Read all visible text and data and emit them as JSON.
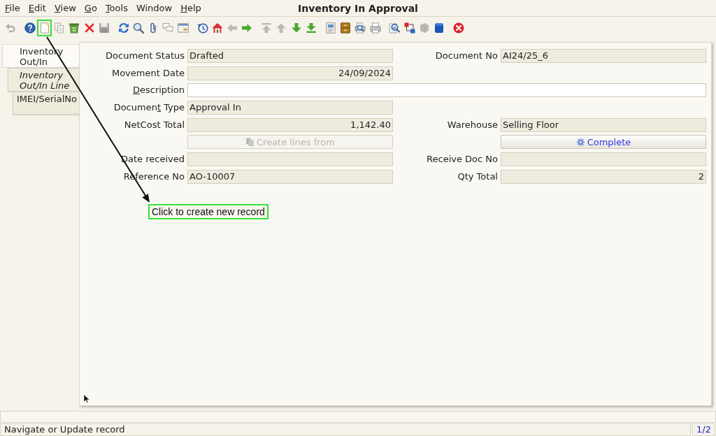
{
  "menu_bar": {
    "items": [
      {
        "label": "File",
        "access_key": true
      },
      {
        "label": "Edit",
        "access_key": true
      },
      {
        "label": "View",
        "access_key": true
      },
      {
        "label": "Go",
        "access_key": true
      },
      {
        "label": "Tools",
        "access_key": true
      },
      {
        "label": "Window",
        "access_key": false
      },
      {
        "label": "Help",
        "access_key": true
      }
    ]
  },
  "window": {
    "title": "Inventory In Approval"
  },
  "toolbar": {
    "groups": [
      {
        "buttons": [
          {
            "kind": "undo",
            "disabled": true,
            "highlighted": false
          }
        ]
      },
      {
        "buttons": [
          {
            "kind": "help",
            "disabled": false,
            "highlighted": false
          },
          {
            "kind": "new",
            "disabled": false,
            "highlighted": true
          },
          {
            "kind": "copy",
            "disabled": false,
            "highlighted": false
          },
          {
            "kind": "bin",
            "disabled": false,
            "highlighted": false
          },
          {
            "kind": "delete",
            "disabled": false,
            "highlighted": false
          },
          {
            "kind": "save",
            "disabled": true,
            "highlighted": false
          }
        ]
      },
      {
        "buttons": [
          {
            "kind": "refresh",
            "disabled": false,
            "highlighted": false
          },
          {
            "kind": "search",
            "disabled": false,
            "highlighted": false
          },
          {
            "kind": "attach",
            "disabled": false,
            "highlighted": false
          },
          {
            "kind": "chat",
            "disabled": false,
            "highlighted": false
          },
          {
            "kind": "table",
            "disabled": false,
            "highlighted": false
          }
        ]
      },
      {
        "buttons": [
          {
            "kind": "history",
            "disabled": false,
            "highlighted": false
          },
          {
            "kind": "home",
            "disabled": false,
            "highlighted": false
          },
          {
            "kind": "prev",
            "disabled": true,
            "highlighted": false
          },
          {
            "kind": "next",
            "disabled": false,
            "highlighted": false
          }
        ]
      },
      {
        "buttons": [
          {
            "kind": "first",
            "disabled": true,
            "highlighted": false
          },
          {
            "kind": "up",
            "disabled": true,
            "highlighted": false
          },
          {
            "kind": "down",
            "disabled": false,
            "highlighted": false
          },
          {
            "kind": "last",
            "disabled": false,
            "highlighted": false
          }
        ]
      },
      {
        "buttons": [
          {
            "kind": "report",
            "disabled": false,
            "highlighted": false
          },
          {
            "kind": "archive",
            "disabled": false,
            "highlighted": false
          },
          {
            "kind": "preview",
            "disabled": false,
            "highlighted": false
          },
          {
            "kind": "print",
            "disabled": false,
            "highlighted": false
          }
        ]
      },
      {
        "buttons": [
          {
            "kind": "zoom",
            "disabled": false,
            "highlighted": false
          },
          {
            "kind": "workflow",
            "disabled": false,
            "highlighted": false
          },
          {
            "kind": "cube",
            "disabled": true,
            "highlighted": false
          },
          {
            "kind": "notebook",
            "disabled": false,
            "highlighted": false
          }
        ]
      },
      {
        "buttons": [
          {
            "kind": "close",
            "disabled": false,
            "highlighted": false
          }
        ]
      }
    ]
  },
  "tabs": [
    {
      "label": "Inventory Out/In",
      "selected": true,
      "italic": false,
      "children": [
        {
          "label": "Inventory Out/In Line",
          "selected": false,
          "italic": true,
          "children": [
            {
              "label": "IMEI/SerialNo",
              "selected": false,
              "italic": false
            }
          ]
        }
      ]
    }
  ],
  "form": {
    "rows": [
      {
        "left": {
          "label": "Document Status",
          "access_key": false,
          "kind": "text",
          "value": "Drafted",
          "read_only": true
        },
        "right": {
          "label": "Document No",
          "access_key": false,
          "kind": "text",
          "value": "AI24/25_6",
          "read_only": true
        }
      },
      {
        "left": {
          "label": "Movement Date",
          "access_key": false,
          "kind": "date",
          "value": "24/09/2024",
          "read_only": true
        }
      },
      {
        "wide": {
          "label": "Description",
          "access_key": true,
          "kind": "text",
          "read_only": false
        }
      },
      {
        "left": {
          "label": "Document Type",
          "access_key": true,
          "kind": "text",
          "value": "Approval In",
          "read_only": true
        }
      },
      {
        "left": {
          "label": "NetCost Total",
          "access_key": false,
          "kind": "number",
          "value": "1,142.40",
          "read_only": true
        },
        "right": {
          "label": "Warehouse",
          "access_key": false,
          "kind": "text",
          "value": "Selling Floor",
          "read_only": true
        }
      },
      {
        "left": {
          "label": "Create lines from",
          "kind": "generator",
          "disabled": true
        },
        "right": {
          "label": "Complete",
          "kind": "action",
          "disabled": false
        }
      },
      {
        "left": {
          "label": "Date received",
          "access_key": false,
          "kind": "date",
          "read_only": true
        },
        "right": {
          "label": "Receive Doc No",
          "access_key": false,
          "kind": "text",
          "read_only": true
        }
      },
      {
        "left": {
          "label": "Reference No",
          "access_key": false,
          "kind": "text",
          "value": "AO-10007",
          "read_only": true
        },
        "right": {
          "label": "Qty Total",
          "access_key": false,
          "kind": "number",
          "value": "2",
          "read_only": true
        }
      }
    ]
  },
  "callout": {
    "text": "Click to create new record"
  },
  "status_bar": {
    "message": "Navigate or Update record",
    "record": "1/2"
  }
}
